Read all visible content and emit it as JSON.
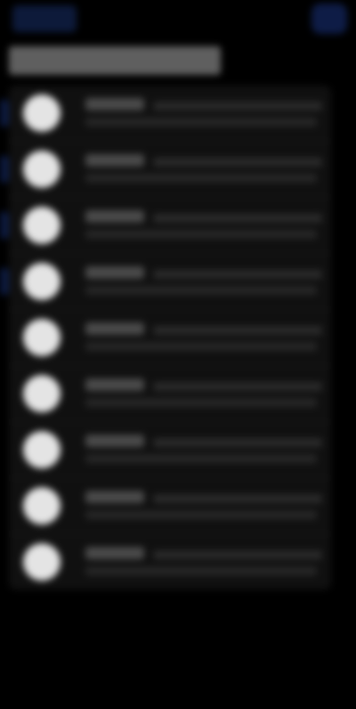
{
  "header": {
    "back_label": "",
    "title": "",
    "action_icon": "action-icon"
  },
  "list": {
    "items": [
      {
        "name": "",
        "value": "",
        "subtitle": ""
      },
      {
        "name": "",
        "value": "",
        "subtitle": ""
      },
      {
        "name": "",
        "value": "",
        "subtitle": ""
      },
      {
        "name": "",
        "value": "",
        "subtitle": ""
      },
      {
        "name": "",
        "value": "",
        "subtitle": ""
      },
      {
        "name": "",
        "value": "",
        "subtitle": ""
      },
      {
        "name": "",
        "value": "",
        "subtitle": ""
      },
      {
        "name": "",
        "value": "",
        "subtitle": ""
      },
      {
        "name": "",
        "value": "",
        "subtitle": ""
      }
    ]
  },
  "colors": {
    "background": "#000000",
    "accent": "#0c1a40",
    "avatar": "#e4e4e4",
    "list_background": "#101010"
  }
}
